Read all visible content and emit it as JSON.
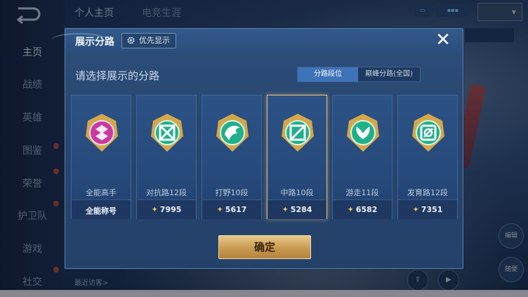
{
  "background": {
    "nav_items": [
      {
        "label": "主页",
        "active": true
      },
      {
        "label": "战绩",
        "active": false
      },
      {
        "label": "英雄",
        "active": false
      },
      {
        "label": "图鉴",
        "active": false
      },
      {
        "label": "荣誉",
        "active": false
      },
      {
        "label": "护卫队",
        "active": false
      },
      {
        "label": "游戏",
        "active": false
      },
      {
        "label": "社交",
        "active": false
      }
    ],
    "top_tabs": [
      "个人主页",
      "电竞生涯"
    ],
    "bottom_label": "最近访客>",
    "side_actions": [
      "编辑",
      "随便"
    ]
  },
  "modal": {
    "title": "展示分路",
    "priority_label": "优先显示",
    "close_icon": "close-icon",
    "subtitle": "请选择展示的分路",
    "segments": [
      {
        "label": "分路段位",
        "active": true
      },
      {
        "label": "巅峰分路(全国)",
        "active": false
      }
    ],
    "cards": [
      {
        "name": "全能高手",
        "score": "",
        "footer": "全能称号",
        "color": "#c83aa0",
        "selected": false,
        "emblem": "all-round-emblem-icon"
      },
      {
        "name": "对抗路12段",
        "score": "7995",
        "footer": "",
        "color": "#1fb08a",
        "selected": false,
        "emblem": "clash-lane-emblem-icon"
      },
      {
        "name": "打野10段",
        "score": "5617",
        "footer": "",
        "color": "#1fb08a",
        "selected": false,
        "emblem": "jungle-emblem-icon"
      },
      {
        "name": "中路10段",
        "score": "5284",
        "footer": "",
        "color": "#1fb08a",
        "selected": true,
        "emblem": "mid-lane-emblem-icon"
      },
      {
        "name": "游走11段",
        "score": "6582",
        "footer": "",
        "color": "#1fb08a",
        "selected": false,
        "emblem": "roam-emblem-icon"
      },
      {
        "name": "发育路12段",
        "score": "7351",
        "footer": "",
        "color": "#1fb08a",
        "selected": false,
        "emblem": "farm-lane-emblem-icon"
      }
    ],
    "confirm_label": "确定"
  },
  "colors": {
    "accent_gold": "#e8c46c",
    "segment_active": "#3d73b8",
    "modal_bg": "#2d4f7b"
  }
}
